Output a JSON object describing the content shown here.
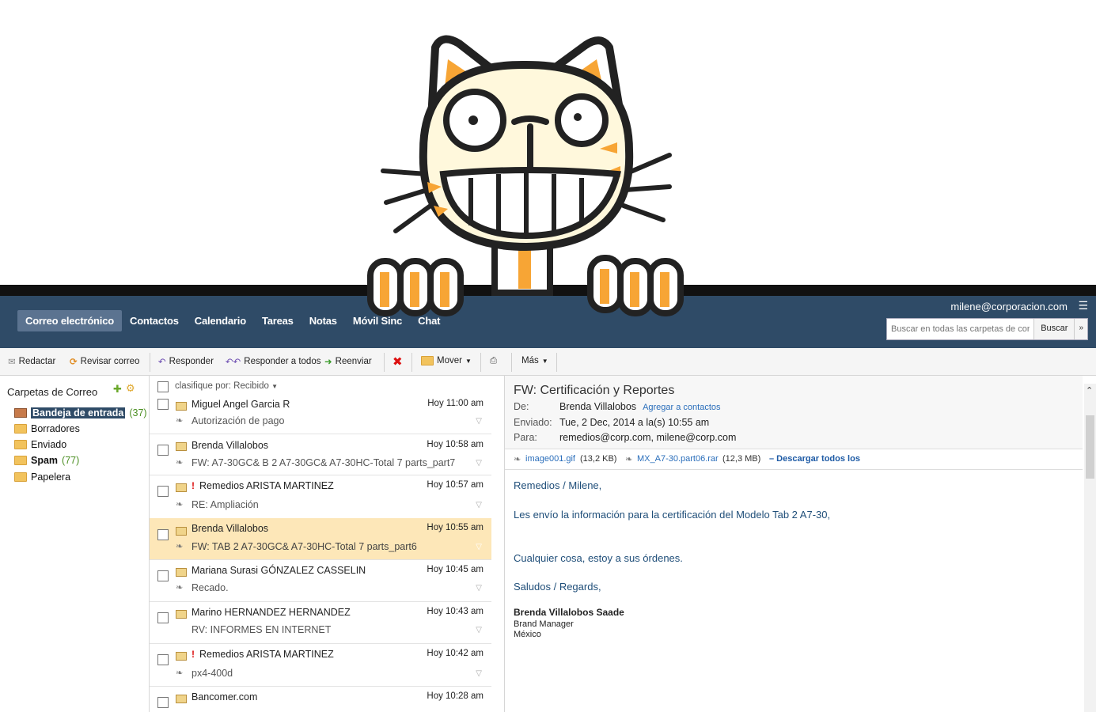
{
  "nav": {
    "tabs": [
      "Correo electrónico",
      "Contactos",
      "Calendario",
      "Tareas",
      "Notas",
      "Móvil Sinc",
      "Chat"
    ],
    "user_email": "milene@corporacion.com",
    "search_placeholder": "Buscar en todas las carpetas de correo",
    "search_button": "Buscar"
  },
  "toolbar": {
    "compose": "Redactar",
    "check_mail": "Revisar correo",
    "reply": "Responder",
    "reply_all": "Responder a todos",
    "forward": "Reenviar",
    "move": "Mover",
    "more": "Más"
  },
  "folders": {
    "title": "Carpetas de Correo",
    "items": [
      {
        "name": "Bandeja de entrada",
        "count": "(37)"
      },
      {
        "name": "Borradores",
        "count": ""
      },
      {
        "name": "Enviado",
        "count": ""
      },
      {
        "name": "Spam",
        "count": "(77)"
      },
      {
        "name": "Papelera",
        "count": ""
      }
    ]
  },
  "list": {
    "sort_label": "clasifique por: Recibido",
    "messages": [
      {
        "sender": "Miguel Angel Garcia R",
        "time": "Hoy 11:00 am",
        "subject": "Autorización de pago"
      },
      {
        "sender": "Brenda Villalobos",
        "time": "Hoy 10:58 am",
        "subject": "FW: A7-30GC& B 2 A7-30GC& A7-30HC-Total 7 parts_part7"
      },
      {
        "sender": "Remedios ARISTA MARTINEZ",
        "time": "Hoy 10:57 am",
        "subject": "RE: Ampliación"
      },
      {
        "sender": "Brenda Villalobos",
        "time": "Hoy 10:55 am",
        "subject": "FW: TAB 2 A7-30GC& A7-30HC-Total 7 parts_part6"
      },
      {
        "sender": "Mariana Surasi GÓNZALEZ CASSELIN",
        "time": "Hoy 10:45 am",
        "subject": "Recado."
      },
      {
        "sender": "Marino HERNANDEZ HERNANDEZ",
        "time": "Hoy 10:43 am",
        "subject": "RV: INFORMES EN INTERNET"
      },
      {
        "sender": "Remedios ARISTA MARTINEZ",
        "time": "Hoy 10:42 am",
        "subject": "px4-400d"
      },
      {
        "sender": "Bancomer.com",
        "time": "Hoy 10:28 am",
        "subject": ""
      }
    ]
  },
  "reading": {
    "subject": "FW: Certificación y Reportes",
    "from_label": "De:",
    "from": "Brenda Villalobos",
    "add_contact": "Agregar a contactos",
    "sent_label": "Enviado:",
    "sent": "Tue, 2 Dec, 2014 a la(s) 10:55 am",
    "to_label": "Para:",
    "to": "remedios@corp.com, milene@corp.com",
    "attachments": [
      {
        "name": "image001.gif",
        "size": "(13,2 KB)"
      },
      {
        "name": "MX_A7-30.part06.rar",
        "size": "(12,3 MB)"
      }
    ],
    "download_all": "– Descargar todos los",
    "body": {
      "greeting": "Remedios / Milene,",
      "line1": "Les envío la información para la certificación del Modelo Tab 2 A7-30,",
      "line2": "Cualquier cosa, estoy a sus órdenes.",
      "closing": "Saludos / Regards,"
    },
    "signature": {
      "name": "Brenda Villalobos Saade",
      "title": "Brand Manager",
      "country": "México"
    }
  },
  "colors": {
    "navbar": "#2f4b67",
    "selected_row": "#fde7b8",
    "body_text": "#1f4e79",
    "cat_orange": "#f7a535"
  }
}
